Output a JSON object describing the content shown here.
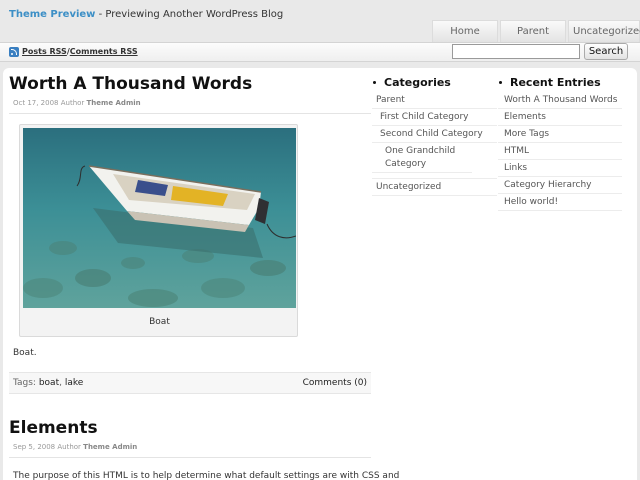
{
  "header": {
    "blog_name": "Theme Preview",
    "separator": " - ",
    "tagline": "Previewing Another WordPress Blog"
  },
  "menu": [
    {
      "label": "Home"
    },
    {
      "label": "Parent"
    },
    {
      "label": "Uncategorized"
    }
  ],
  "toolbar": {
    "posts_rss": "Posts RSS",
    "divider": "/",
    "comments_rss": "Comments RSS",
    "search_value": "",
    "search_button": "Search",
    "rss_icon": "rss-icon"
  },
  "posts": [
    {
      "title": "Worth A Thousand Words",
      "date": "Oct 17, 2008",
      "author_prefix": " Author ",
      "author": "Theme Admin",
      "image_caption": "Boat",
      "body": "Boat.",
      "tags_label": "Tags: ",
      "tags": [
        "boat",
        "lake"
      ],
      "tags_sep": ", ",
      "comments": "Comments (0)"
    },
    {
      "title": "Elements",
      "date": "Sep 5, 2008",
      "author_prefix": " Author ",
      "author": "Theme Admin",
      "body": "The purpose of this HTML is to help determine what default settings are with CSS and"
    }
  ],
  "categories": {
    "heading": "Categories",
    "items": [
      {
        "label": "Parent"
      },
      {
        "label": "First Child Category"
      },
      {
        "label": "Second Child Category"
      },
      {
        "label": "One Grandchild Category"
      },
      {
        "label": "Uncategorized"
      }
    ]
  },
  "recent": {
    "heading": "Recent Entries",
    "items": [
      {
        "label": "Worth A Thousand Words"
      },
      {
        "label": "Elements"
      },
      {
        "label": "More Tags"
      },
      {
        "label": "HTML"
      },
      {
        "label": "Links"
      },
      {
        "label": "Category Hierarchy"
      },
      {
        "label": "Hello world!"
      }
    ]
  },
  "colors": {
    "accent": "#3c8fc6",
    "background": "#e9e9e9"
  }
}
